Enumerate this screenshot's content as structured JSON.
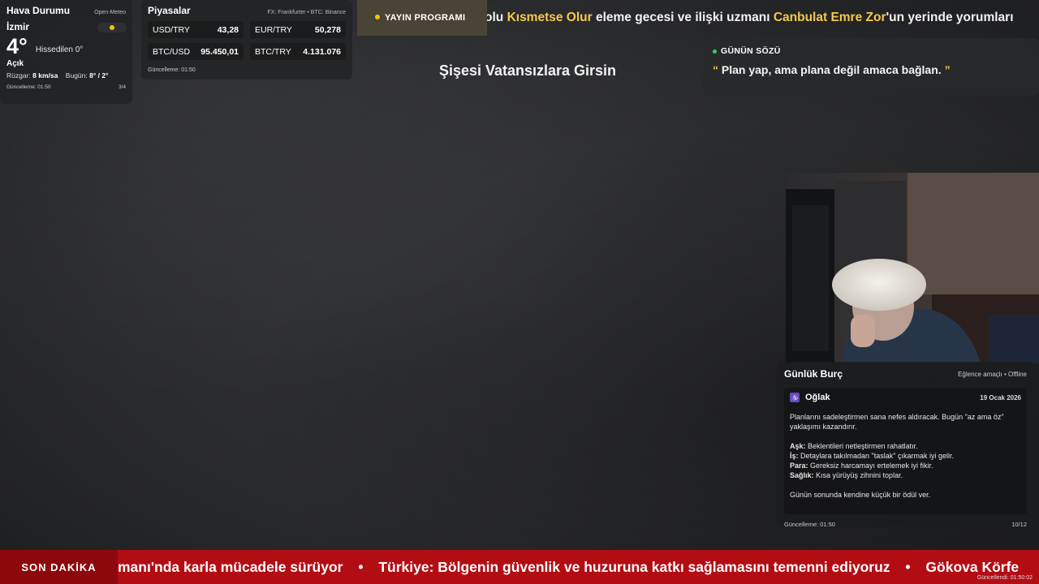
{
  "weather": {
    "title": "Hava Durumu",
    "source": "Open-Meteo",
    "city": "İzmir",
    "temperature": "4°",
    "feels_like": "Hissedilen 0°",
    "condition": "Açık",
    "wind_label": "Rüzgar:",
    "wind_value": "8 km/sa",
    "today_label": "Bugün:",
    "today_value": "8° / 2°",
    "updated": "Güncelleme: 01:50",
    "page": "3/4",
    "icon": "sun-icon",
    "icon_color": "#f2c200"
  },
  "markets": {
    "title": "Piyasalar",
    "source": "FX: Frankfurter • BTC: Binance",
    "rates": [
      {
        "pair": "USD/TRY",
        "value": "43,28"
      },
      {
        "pair": "EUR/TRY",
        "value": "50,278"
      },
      {
        "pair": "BTC/USD",
        "value": "95.450,01"
      },
      {
        "pair": "BTC/TRY",
        "value": "4.131.076"
      }
    ],
    "updated": "Güncelleme: 01:50"
  },
  "schedule": {
    "label": "YAYIN PROGRAMI",
    "text_pre": "olu ",
    "hl1": "Kısmetse Olur",
    "text_mid": " eleme gecesi ve ilişki uzmanı ",
    "hl2": "Canbulat Emre Zor",
    "text_post": "'un yerinde yorumları",
    "highlight_color": "#f5c84b"
  },
  "center_title": "Şişesi Vatansızlara Girsin",
  "quote": {
    "label": "GÜNÜN SÖZÜ",
    "open_mark": "“",
    "text": "Plan yap, ama plana değil amaca bağlan.",
    "close_mark": "”"
  },
  "horoscope": {
    "title": "Günlük Burç",
    "note": "Eğlence amaçlı • Offline",
    "sign_symbol": "♑",
    "sign": "Oğlak",
    "date": "19 Ocak 2026",
    "intro": "Planlarını sadeleştirmen sana nefes aldıracak. Bugün \"az ama öz\" yaklaşımı kazandırır.",
    "love_label": "Aşk:",
    "love": " Beklentileri netleştirmen rahatlatır.",
    "work_label": "İş:",
    "work": " Detaylara takılmadan \"taslak\" çıkarmak iyi gelir.",
    "money_label": "Para:",
    "money": " Gereksiz harcamayı ertelemek iyi fikir.",
    "health_label": "Sağlık:",
    "health": " Kısa yürüyüş zihnini toplar.",
    "closing": "Günün sonunda kendine küçük bir ödül ver.",
    "updated": "Güncelleme: 01:50",
    "page": "10/12"
  },
  "news": {
    "label": "SON DAKİKA",
    "item1": "manı'nda karla mücadele sürüyor",
    "sep": "•",
    "item2": "Türkiye: Bölgenin güvenlik ve huzuruna katkı sağlamasını temenni ediyoruz",
    "item3": "Gökova Körfe",
    "updated": "Güncellendi: 01:50:02"
  }
}
